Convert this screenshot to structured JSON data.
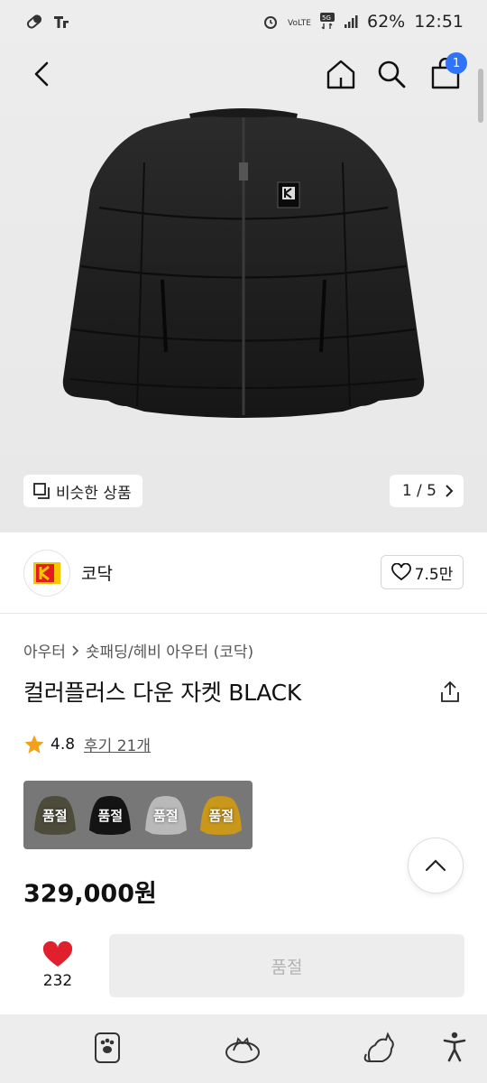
{
  "status_bar": {
    "battery": "62%",
    "time": "12:51",
    "network": "5G"
  },
  "header": {
    "cart_count": "1"
  },
  "hero": {
    "similar_label": "비슷한 상품",
    "pager": "1 / 5"
  },
  "brand": {
    "name": "코닥",
    "likes": "7.5만",
    "logo_color": "#e31b23",
    "logo_accent": "#f7c600"
  },
  "product": {
    "breadcrumb_1": "아우터",
    "breadcrumb_2": "숏패딩/헤비 아우터 (코닥)",
    "title": "컬러플러스 다운 자켓 BLACK",
    "rating": "4.8",
    "reviews": "후기 21개",
    "price": "329,000원"
  },
  "swatches": [
    {
      "label": "품절",
      "color": "#4d4b3a"
    },
    {
      "label": "품절",
      "color": "#141414"
    },
    {
      "label": "품절",
      "color": "#b9b9b9"
    },
    {
      "label": "품절",
      "color": "#c9971a"
    }
  ],
  "actions": {
    "wish_count": "232",
    "buy_label": "품절"
  },
  "colors": {
    "accent_blue": "#2f74f6",
    "heart_red": "#e0202d",
    "star_orange": "#f2a21a"
  }
}
